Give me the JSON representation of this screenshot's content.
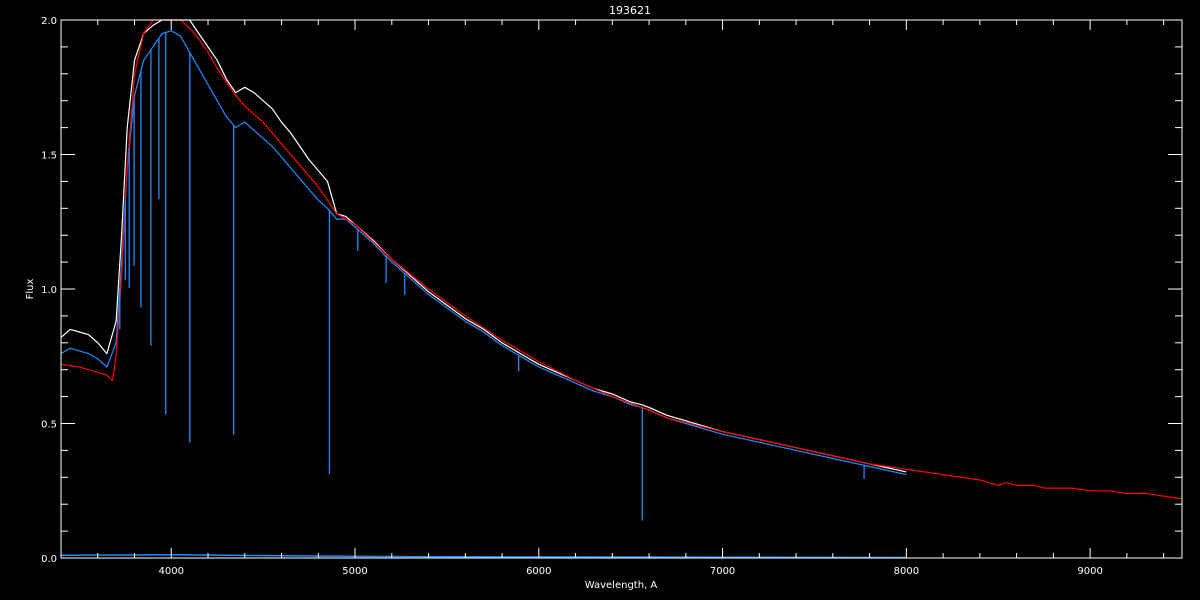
{
  "chart_data": {
    "type": "line",
    "title": "193621",
    "xlabel": "Wavelength, A",
    "ylabel": "Flux",
    "xlim": [
      3400,
      9500
    ],
    "ylim": [
      0,
      2.0
    ],
    "x_ticks": [
      4000,
      5000,
      6000,
      7000,
      8000,
      9000
    ],
    "x_tick_labels": [
      "4000",
      "5000",
      "6000",
      "7000",
      "8000",
      "9000"
    ],
    "y_ticks": [
      0.0,
      0.5,
      1.0,
      1.5,
      2.0
    ],
    "y_tick_labels": [
      "0.0",
      "0.5",
      "1.0",
      "1.5",
      "2.0"
    ],
    "grid": false,
    "background": "#000000",
    "axis_color": "#ffffff",
    "series": [
      {
        "color": "#ffffff",
        "x": [
          3400,
          3450,
          3500,
          3550,
          3600,
          3650,
          3700,
          3730,
          3760,
          3800,
          3850,
          3900,
          3950,
          4000,
          4050,
          4100,
          4150,
          4200,
          4250,
          4300,
          4350,
          4400,
          4450,
          4500,
          4550,
          4600,
          4650,
          4700,
          4750,
          4800,
          4850,
          4900,
          4950,
          5000,
          5100,
          5200,
          5300,
          5400,
          5500,
          5600,
          5700,
          5800,
          5900,
          6000,
          6100,
          6200,
          6300,
          6400,
          6500,
          6560,
          6600,
          6700,
          6800,
          6900,
          7000,
          7200,
          7400,
          7600,
          7800,
          8000
        ],
        "y": [
          0.82,
          0.85,
          0.84,
          0.83,
          0.8,
          0.76,
          0.88,
          1.2,
          1.6,
          1.85,
          1.95,
          1.98,
          2.02,
          2.03,
          2.02,
          2.0,
          1.95,
          1.9,
          1.85,
          1.78,
          1.73,
          1.75,
          1.73,
          1.7,
          1.67,
          1.62,
          1.58,
          1.53,
          1.48,
          1.44,
          1.4,
          1.28,
          1.27,
          1.24,
          1.18,
          1.11,
          1.05,
          0.99,
          0.94,
          0.89,
          0.85,
          0.8,
          0.76,
          0.72,
          0.69,
          0.66,
          0.63,
          0.61,
          0.58,
          0.57,
          0.56,
          0.53,
          0.51,
          0.49,
          0.47,
          0.44,
          0.41,
          0.38,
          0.35,
          0.32
        ]
      },
      {
        "color": "#1e8cff",
        "x": [
          3400,
          3450,
          3500,
          3550,
          3600,
          3650,
          3700,
          3730,
          3760,
          3800,
          3850,
          3900,
          3950,
          4000,
          4050,
          4100,
          4150,
          4200,
          4250,
          4300,
          4350,
          4400,
          4450,
          4500,
          4550,
          4600,
          4650,
          4700,
          4750,
          4800,
          4850,
          4900,
          4950,
          5000,
          5100,
          5200,
          5300,
          5400,
          5500,
          5600,
          5700,
          5800,
          5900,
          6000,
          6100,
          6200,
          6300,
          6400,
          6500,
          6560,
          6600,
          6700,
          6800,
          6900,
          7000,
          7200,
          7400,
          7600,
          7800,
          8000
        ],
        "y": [
          0.76,
          0.78,
          0.77,
          0.76,
          0.74,
          0.71,
          0.8,
          1.1,
          1.45,
          1.72,
          1.85,
          1.9,
          1.95,
          1.96,
          1.94,
          1.88,
          1.82,
          1.76,
          1.7,
          1.64,
          1.6,
          1.62,
          1.59,
          1.56,
          1.53,
          1.49,
          1.45,
          1.41,
          1.37,
          1.33,
          1.3,
          1.26,
          1.26,
          1.23,
          1.17,
          1.1,
          1.04,
          0.98,
          0.93,
          0.88,
          0.84,
          0.79,
          0.75,
          0.71,
          0.68,
          0.65,
          0.62,
          0.6,
          0.57,
          0.56,
          0.55,
          0.52,
          0.5,
          0.48,
          0.46,
          0.43,
          0.4,
          0.37,
          0.34,
          0.31
        ]
      },
      {
        "color": "#ff0000",
        "x": [
          3400,
          3500,
          3550,
          3600,
          3650,
          3680,
          3700,
          3730,
          3760,
          3800,
          3850,
          3900,
          3950,
          4000,
          4050,
          4100,
          4150,
          4200,
          4250,
          4300,
          4350,
          4400,
          4450,
          4500,
          4600,
          4700,
          4800,
          4850,
          4900,
          5000,
          5200,
          5400,
          5600,
          5800,
          6000,
          6200,
          6400,
          6562,
          6700,
          7000,
          7400,
          7800,
          8200,
          8400,
          8450,
          8500,
          8540,
          8600,
          8660,
          8700,
          8750,
          8800,
          8860,
          8900,
          9000,
          9100,
          9200,
          9230,
          9300,
          9500
        ],
        "y": [
          0.72,
          0.71,
          0.7,
          0.69,
          0.68,
          0.66,
          0.75,
          1.05,
          1.45,
          1.8,
          1.95,
          2.0,
          2.03,
          2.03,
          2.0,
          1.97,
          1.93,
          1.88,
          1.82,
          1.77,
          1.72,
          1.68,
          1.65,
          1.62,
          1.54,
          1.46,
          1.38,
          1.33,
          1.28,
          1.24,
          1.11,
          1.0,
          0.9,
          0.81,
          0.73,
          0.66,
          0.6,
          0.56,
          0.52,
          0.47,
          0.41,
          0.35,
          0.31,
          0.29,
          0.28,
          0.27,
          0.28,
          0.27,
          0.27,
          0.27,
          0.26,
          0.26,
          0.26,
          0.26,
          0.25,
          0.25,
          0.24,
          0.24,
          0.24,
          0.22
        ]
      },
      {
        "color": "#1e8cff",
        "x": [
          3400,
          4000,
          5000,
          6000,
          7000,
          8000
        ],
        "y": [
          0.01,
          0.012,
          0.006,
          0.004,
          0.003,
          0.002
        ]
      }
    ],
    "absorption_lines": [
      {
        "x": 3720,
        "depth": 0.15
      },
      {
        "x": 3750,
        "depth": 0.3
      },
      {
        "x": 3771,
        "depth": 0.52
      },
      {
        "x": 3798,
        "depth": 0.62
      },
      {
        "x": 3835,
        "depth": 0.88
      },
      {
        "x": 3889,
        "depth": 1.1
      },
      {
        "x": 3933,
        "depth": 0.6
      },
      {
        "x": 3970,
        "depth": 1.42
      },
      {
        "x": 4101,
        "depth": 1.45
      },
      {
        "x": 4340,
        "depth": 1.15
      },
      {
        "x": 4861,
        "depth": 0.98
      },
      {
        "x": 5015,
        "depth": 0.08
      },
      {
        "x": 5169,
        "depth": 0.1
      },
      {
        "x": 5270,
        "depth": 0.08
      },
      {
        "x": 5890,
        "depth": 0.06
      },
      {
        "x": 6563,
        "depth": 0.42
      },
      {
        "x": 7770,
        "depth": 0.05
      }
    ]
  }
}
